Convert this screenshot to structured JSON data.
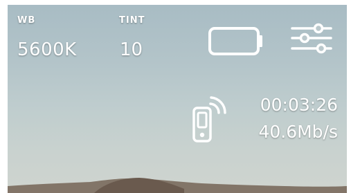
{
  "camera": {
    "white_balance": {
      "label": "WB",
      "value": "5600K"
    },
    "tint": {
      "label": "TINT",
      "value": "10"
    },
    "timecode": "00:03:26",
    "bitrate": "40.6Mb/s"
  },
  "icons": {
    "battery": "battery-icon",
    "settings": "sliders-settings-icon",
    "stream": "mobile-streaming-icon"
  },
  "colors": {
    "overlay_text": "#ffffff",
    "sky_top": "#a8bcc4",
    "sky_bottom": "#cfd4cf"
  }
}
